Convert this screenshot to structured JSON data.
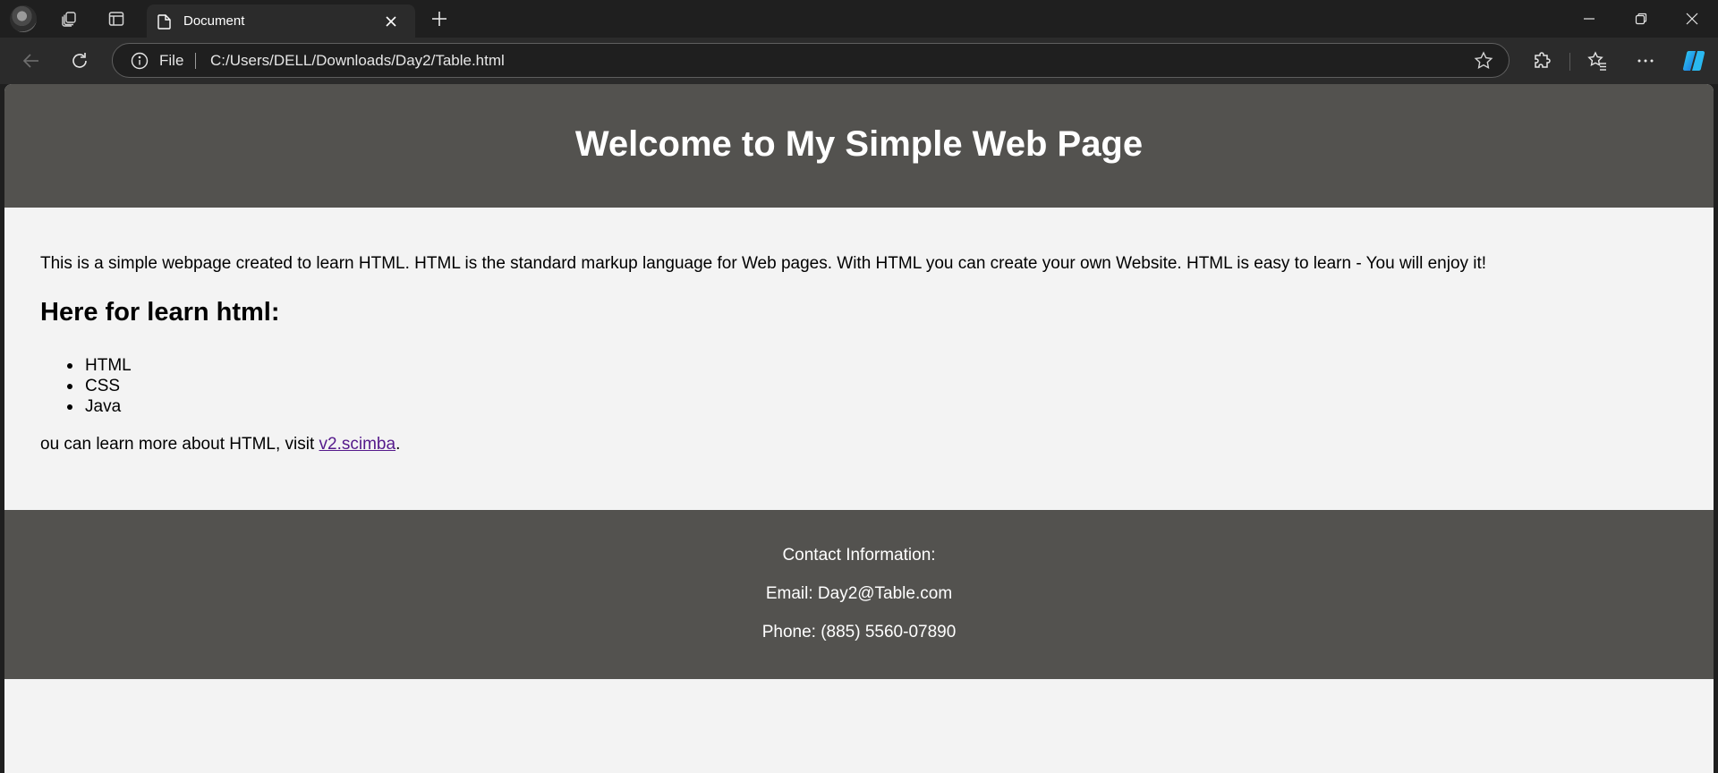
{
  "browser": {
    "tab": {
      "title": "Document"
    },
    "address": {
      "scheme_label": "File",
      "url": "C:/Users/DELL/Downloads/Day2/Table.html"
    }
  },
  "page": {
    "header_title": "Welcome to My Simple Web Page",
    "intro_text": "This is a simple webpage created to learn HTML. HTML is the standard markup language for Web pages. With HTML you can create your own Website. HTML is easy to learn - You will enjoy it!",
    "section_title": "Here for learn html:",
    "list_items": [
      "HTML",
      "CSS",
      "Java"
    ],
    "more_prefix": "ou can learn more about HTML, visit ",
    "more_link": "v2.scimba",
    "more_suffix": ".",
    "footer": {
      "contact_title": "Contact Information:",
      "email": "Email: Day2@Table.com",
      "phone": "Phone: (885) 5560-07890"
    }
  },
  "colors": {
    "header_bg": "#53524f",
    "page_bg": "#f3f3f3",
    "link": "#551a8b",
    "chrome_dark": "#1f1f1f",
    "chrome_toolbar": "#2b2b2b"
  }
}
